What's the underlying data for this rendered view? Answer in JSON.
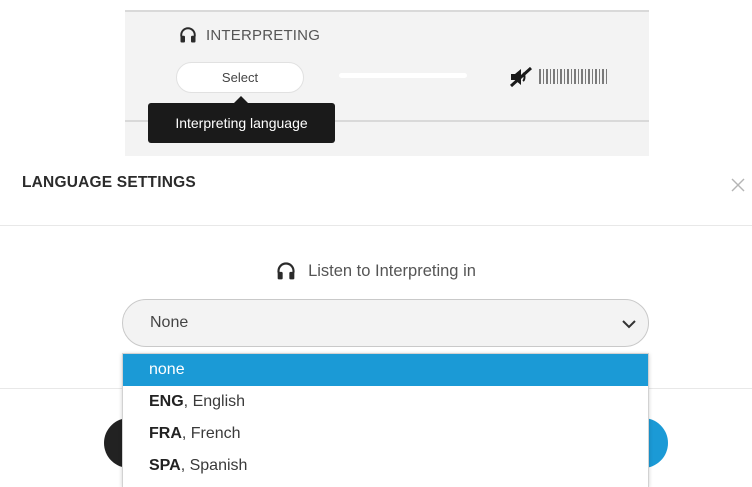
{
  "interpreting": {
    "title": "INTERPRETING",
    "select_label": "Select",
    "tooltip": "Interpreting language",
    "icons": {
      "title": "headphones-icon",
      "audio": "speaker-muted-icon"
    }
  },
  "language_settings": {
    "title": "LANGUAGE SETTINGS",
    "close_icon": "close-icon",
    "listen_label": "Listen to Interpreting in",
    "selected_value": "None",
    "options": [
      {
        "code": "",
        "name": "none",
        "selected": true
      },
      {
        "code": "ENG",
        "name": ", English",
        "selected": false
      },
      {
        "code": "FRA",
        "name": ", French",
        "selected": false
      },
      {
        "code": "SPA",
        "name": ", Spanish",
        "selected": false
      }
    ]
  },
  "colors": {
    "accent": "#1b9ad6",
    "tooltip_bg": "#1a1a1a",
    "panel_bg": "#f3f3f3"
  }
}
